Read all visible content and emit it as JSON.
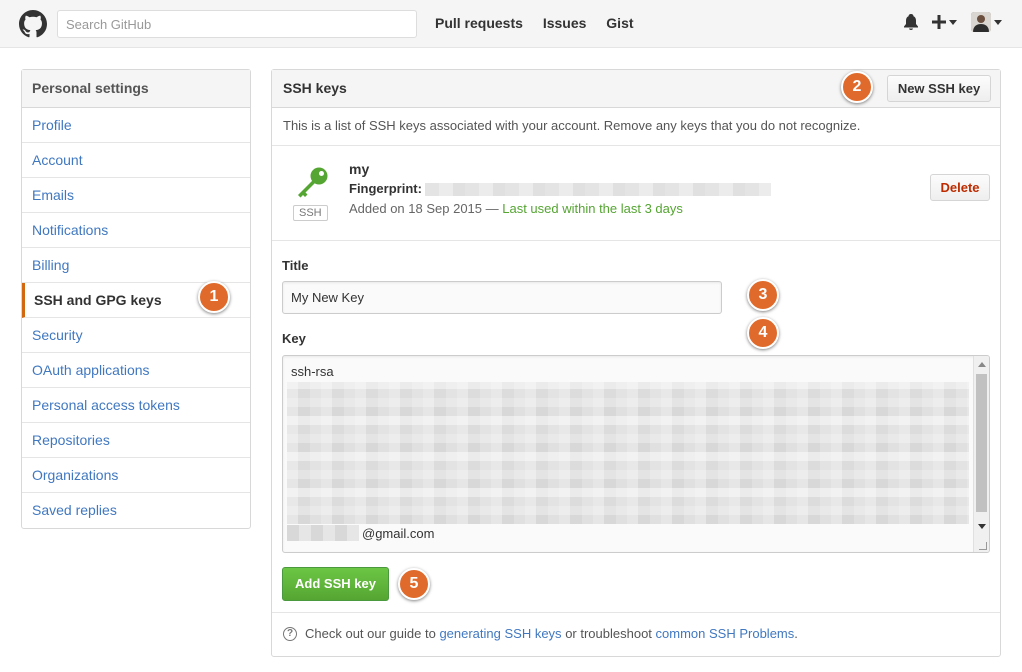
{
  "header": {
    "search_placeholder": "Search GitHub",
    "nav": [
      "Pull requests",
      "Issues",
      "Gist"
    ]
  },
  "sidebar": {
    "title": "Personal settings",
    "items": [
      {
        "label": "Profile"
      },
      {
        "label": "Account"
      },
      {
        "label": "Emails"
      },
      {
        "label": "Notifications"
      },
      {
        "label": "Billing"
      },
      {
        "label": "SSH and GPG keys",
        "active": true
      },
      {
        "label": "Security"
      },
      {
        "label": "OAuth applications"
      },
      {
        "label": "Personal access tokens"
      },
      {
        "label": "Repositories"
      },
      {
        "label": "Organizations"
      },
      {
        "label": "Saved replies"
      }
    ]
  },
  "main": {
    "title": "SSH keys",
    "new_button": "New SSH key",
    "intro": "This is a list of SSH keys associated with your account. Remove any keys that you do not recognize.",
    "key": {
      "name": "my",
      "fingerprint_label": "Fingerprint:",
      "type_label": "SSH",
      "added_text": "Added on 18 Sep 2015 — ",
      "last_used": "Last used within the last 3 days",
      "delete_button": "Delete"
    },
    "form": {
      "title_label": "Title",
      "title_value": "My New Key",
      "key_label": "Key",
      "key_prefix": "ssh-rsa",
      "key_email_suffix": "@gmail.com",
      "add_button": "Add SSH key"
    },
    "footer": {
      "prefix": "Check out our guide to ",
      "link1": "generating SSH keys",
      "middle": " or troubleshoot ",
      "link2": "common SSH Problems",
      "suffix": "."
    }
  },
  "badges": [
    "1",
    "2",
    "3",
    "4",
    "5"
  ],
  "colors": {
    "badge": "#e06a2b",
    "link": "#4078c0",
    "green": "#55a532",
    "active_border": "#d26911"
  }
}
